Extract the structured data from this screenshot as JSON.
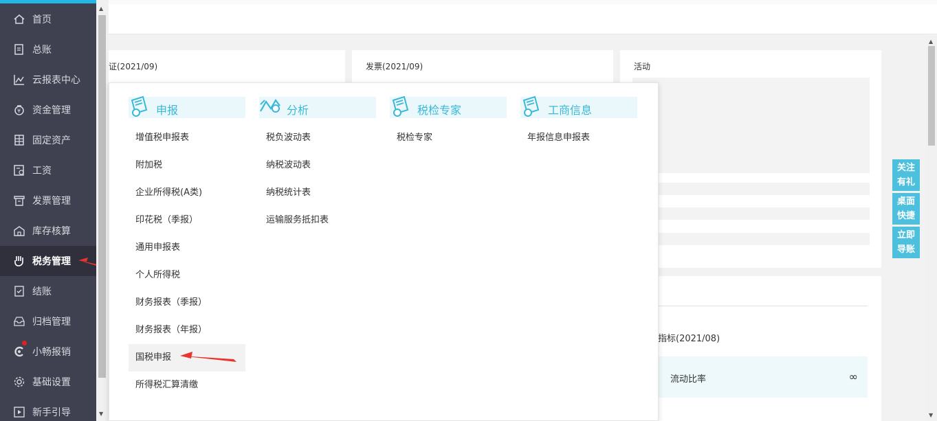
{
  "sidebar": {
    "items": [
      {
        "label": "首页",
        "icon": "home-icon"
      },
      {
        "label": "总账",
        "icon": "ledger-icon"
      },
      {
        "label": "云报表中心",
        "icon": "chart-icon"
      },
      {
        "label": "资金管理",
        "icon": "money-bag-icon"
      },
      {
        "label": "固定资产",
        "icon": "building-icon"
      },
      {
        "label": "工资",
        "icon": "salary-icon"
      },
      {
        "label": "发票管理",
        "icon": "invoice-icon"
      },
      {
        "label": "库存核算",
        "icon": "warehouse-icon"
      },
      {
        "label": "税务管理",
        "icon": "tax-hand-icon"
      },
      {
        "label": "结账",
        "icon": "checkout-icon"
      },
      {
        "label": "归档管理",
        "icon": "archive-icon"
      },
      {
        "label": "小畅报销",
        "icon": "reimburse-icon"
      },
      {
        "label": "基础设置",
        "icon": "gear-icon"
      },
      {
        "label": "新手引导",
        "icon": "play-guide-icon"
      }
    ],
    "active": "税务管理"
  },
  "cards": {
    "voucher_title": "证(2021/09)",
    "invoice_title": "发票(2021/09)",
    "activity_title": "活动",
    "indicator_title": "指标(2021/08)",
    "ratio_label": "流动比率",
    "ratio_value": "∞"
  },
  "float_buttons": [
    {
      "line1": "关注",
      "line2": "有礼"
    },
    {
      "line1": "桌面",
      "line2": "快捷"
    },
    {
      "line1": "立即",
      "line2": "导账"
    }
  ],
  "menu": {
    "columns": [
      {
        "title": "申报",
        "items": [
          "增值税申报表",
          "附加税",
          "企业所得税(A类)",
          "印花税（季报）",
          "通用申报表",
          "个人所得税",
          "财务报表（季报）",
          "财务报表（年报）",
          "国税申报",
          "所得税汇算清缴"
        ]
      },
      {
        "title": "分析",
        "items": [
          "税负波动表",
          "纳税波动表",
          "纳税统计表",
          "运输服务抵扣表"
        ]
      },
      {
        "title": "税检专家",
        "items": [
          "税检专家"
        ]
      },
      {
        "title": "工商信息",
        "items": [
          "年报信息申报表"
        ]
      }
    ],
    "highlighted_item": "国税申报"
  },
  "colors": {
    "sidebar_bg": "#3f4150",
    "accent": "#4cc0dd",
    "header_text": "#3ab8d8",
    "arrow": "#e8352e"
  }
}
